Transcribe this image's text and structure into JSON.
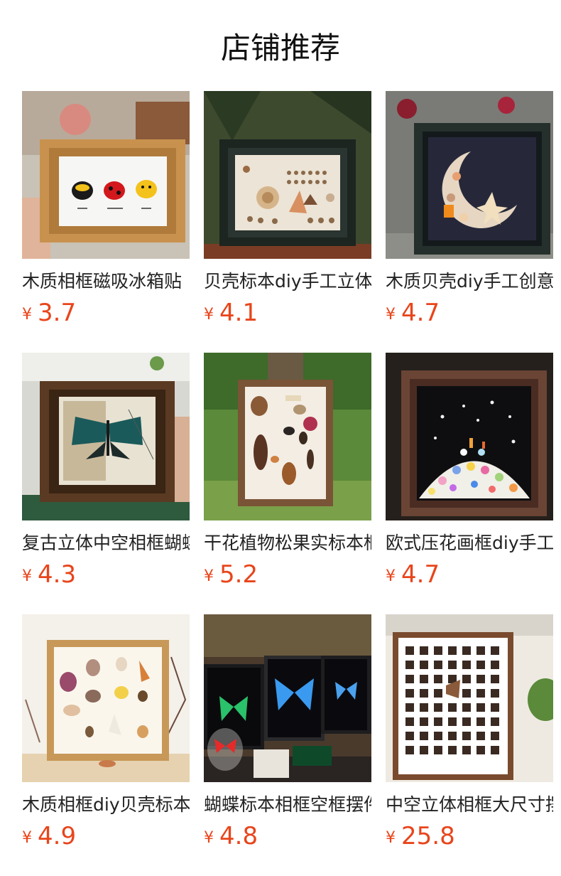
{
  "page": {
    "title": "店铺推荐"
  },
  "colors": {
    "price": "#e8451b",
    "title": "#111111",
    "name": "#222222"
  },
  "products": [
    {
      "name": "木质相框磁吸冰箱贴",
      "currency": "¥",
      "price": "3.7",
      "image": "ladybug-frame-image"
    },
    {
      "name": "贝壳标本diy手工立体",
      "currency": "¥",
      "price": "4.1",
      "image": "shell-specimen-frame-image"
    },
    {
      "name": "木质贝壳diy手工创意",
      "currency": "¥",
      "price": "4.7",
      "image": "shell-moon-frame-image"
    },
    {
      "name": "复古立体中空相框蝴蝶",
      "currency": "¥",
      "price": "4.3",
      "image": "butterfly-vintage-frame-image"
    },
    {
      "name": "干花植物松果实标本框",
      "currency": "¥",
      "price": "5.2",
      "image": "pinecone-specimen-frame-image"
    },
    {
      "name": "欧式压花画框diy手工",
      "currency": "¥",
      "price": "4.7",
      "image": "pressed-flower-frame-image"
    },
    {
      "name": "木质相框diy贝壳标本",
      "currency": "¥",
      "price": "4.9",
      "image": "labeled-shell-frame-image"
    },
    {
      "name": "蝴蝶标本相框空框摆件",
      "currency": "¥",
      "price": "4.8",
      "image": "butterfly-display-frames-image"
    },
    {
      "name": "中空立体相框大尺寸摆",
      "currency": "¥",
      "price": "25.8",
      "image": "grid-specimen-frame-image"
    }
  ]
}
